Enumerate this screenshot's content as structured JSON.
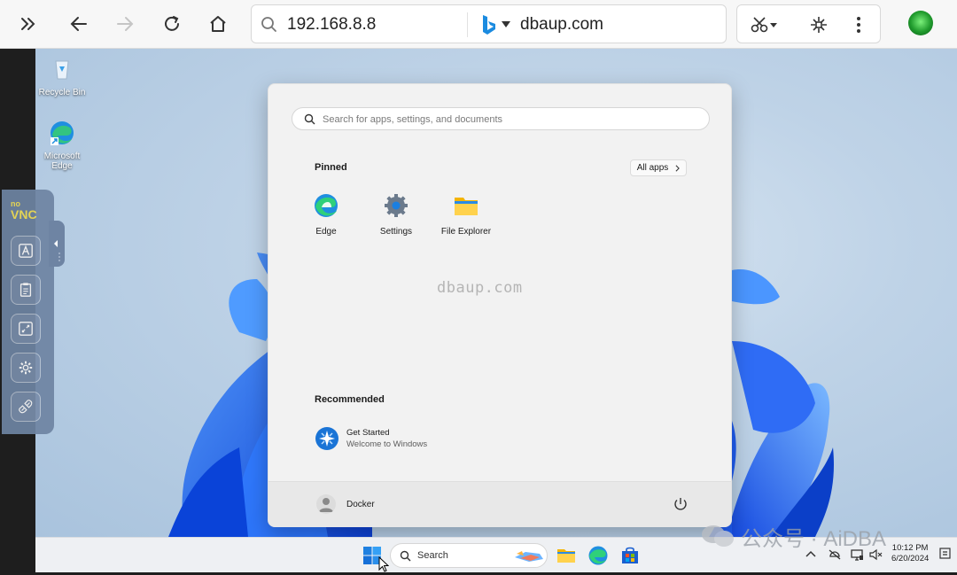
{
  "browser": {
    "url": "192.168.8.8",
    "search_engine": "dbaup.com",
    "icons": {
      "sidebar": "double-chevron-right-icon",
      "back": "back-arrow-icon",
      "forward": "forward-arrow-icon",
      "reload": "reload-icon",
      "home": "home-icon",
      "search": "search-icon",
      "engine": "bing-icon",
      "tools": [
        "scissors-icon",
        "extension-icon",
        "more-vert-icon"
      ],
      "profile": "profile-avatar-icon"
    }
  },
  "desktop": {
    "icons": [
      {
        "label": "Recycle Bin",
        "icon": "recycle-bin-icon"
      },
      {
        "label": "Microsoft Edge",
        "icon": "edge-icon"
      }
    ]
  },
  "novnc": {
    "logo_top": "no",
    "logo_bottom": "VNC",
    "buttons": [
      "keyboard-icon",
      "clipboard-icon",
      "fullscreen-icon",
      "settings-icon",
      "disconnect-icon"
    ]
  },
  "start_menu": {
    "search_placeholder": "Search for apps, settings, and documents",
    "pinned_title": "Pinned",
    "all_apps_label": "All apps",
    "pinned_apps": [
      {
        "label": "Edge",
        "icon": "edge-icon"
      },
      {
        "label": "Settings",
        "icon": "settings-icon"
      },
      {
        "label": "File Explorer",
        "icon": "file-explorer-icon"
      }
    ],
    "watermark": "dbaup.com",
    "recommended_title": "Recommended",
    "recommended": [
      {
        "title": "Get Started",
        "subtitle": "Welcome to Windows",
        "icon": "get-started-icon"
      }
    ],
    "user_name": "Docker"
  },
  "taskbar": {
    "search_label": "Search",
    "apps": [
      "file-explorer-icon",
      "edge-icon",
      "store-icon"
    ],
    "tray": [
      "chevron-up-icon",
      "network-icon",
      "display-icon",
      "volume-icon"
    ],
    "time": "10:12 PM",
    "date": "6/20/2024"
  },
  "watermark": {
    "text": "公众号 · AiDBA"
  },
  "colors": {
    "accent": "#0067c0",
    "bloom": "#1a5fe0",
    "novnc": "#6e84a3"
  }
}
